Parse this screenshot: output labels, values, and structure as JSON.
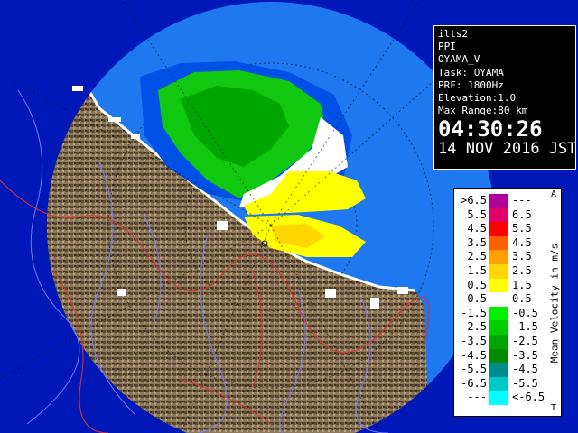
{
  "info": {
    "station": "ilts2",
    "product": "PPI",
    "volume": "OYAMA_V",
    "task": "Task: OYAMA",
    "prf": "PRF: 1800Hz",
    "elevation": "Elevation:1.0",
    "max_range": "Max Range:80 km",
    "time": "04:30:26",
    "date": "14 NOV 2016 JST"
  },
  "legend": {
    "title": "Mean Velocity in m/s",
    "mark_top": "A",
    "mark_bottom": "T",
    "rows": [
      {
        "min": ">6.5",
        "max": "---",
        "color": "#b0009a"
      },
      {
        "min": "5.5",
        "max": "6.5",
        "color": "#e0006a"
      },
      {
        "min": "4.5",
        "max": "5.5",
        "color": "#ff0000"
      },
      {
        "min": "3.5",
        "max": "4.5",
        "color": "#ff6000"
      },
      {
        "min": "2.5",
        "max": "3.5",
        "color": "#ffa000"
      },
      {
        "min": "1.5",
        "max": "2.5",
        "color": "#ffd700"
      },
      {
        "min": "0.5",
        "max": "1.5",
        "color": "#ffff00"
      },
      {
        "min": "-0.5",
        "max": "0.5",
        "color": "#ffffff"
      },
      {
        "min": "-1.5",
        "max": "-0.5",
        "color": "#00f000"
      },
      {
        "min": "-2.5",
        "max": "-1.5",
        "color": "#00cc00"
      },
      {
        "min": "-3.5",
        "max": "-2.5",
        "color": "#00a600"
      },
      {
        "min": "-4.5",
        "max": "-3.5",
        "color": "#008a00"
      },
      {
        "min": "-5.5",
        "max": "-4.5",
        "color": "#008c8c"
      },
      {
        "min": "-6.5",
        "max": "-5.5",
        "color": "#00c8c8"
      },
      {
        "min": "---",
        "max": "<-6.5",
        "color": "#00ffff"
      }
    ]
  },
  "colors": {
    "sea_blue": "#1e78f0",
    "range_blue": "#0050e6",
    "terrain": "#8a7556",
    "river": "#7777ff",
    "border": "#e03030"
  }
}
